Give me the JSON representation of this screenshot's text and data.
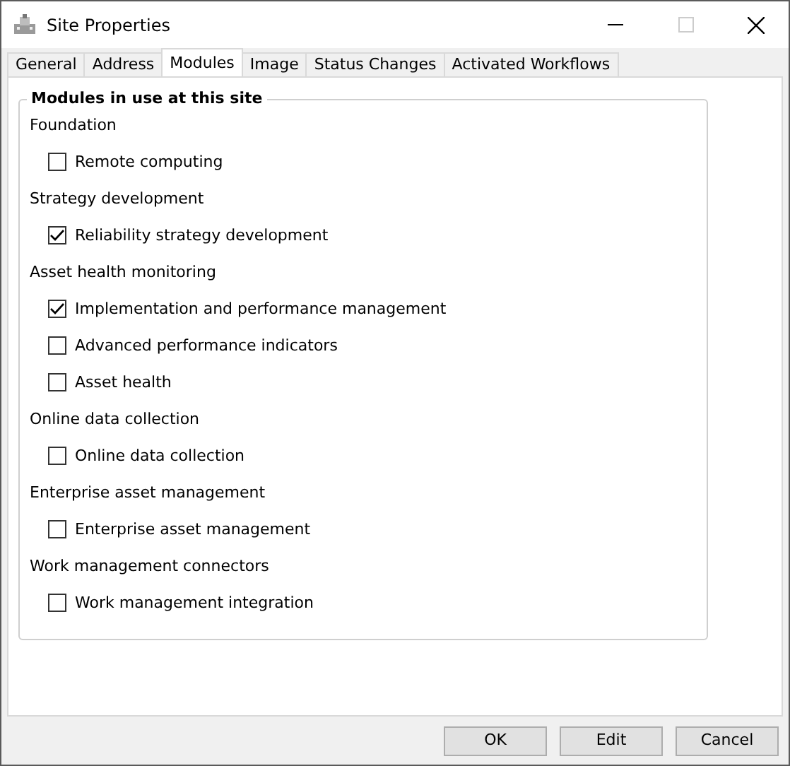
{
  "window": {
    "title": "Site Properties"
  },
  "tabs": [
    {
      "label": "General",
      "selected": false
    },
    {
      "label": "Address",
      "selected": false
    },
    {
      "label": "Modules",
      "selected": true
    },
    {
      "label": "Image",
      "selected": false
    },
    {
      "label": "Status Changes",
      "selected": false
    },
    {
      "label": "Activated Workflows",
      "selected": false
    }
  ],
  "group": {
    "title": "Modules in use at this site",
    "sections": [
      {
        "heading": "Foundation",
        "items": [
          {
            "label": "Remote computing",
            "checked": false
          }
        ]
      },
      {
        "heading": "Strategy development",
        "items": [
          {
            "label": "Reliability strategy development",
            "checked": true
          }
        ]
      },
      {
        "heading": "Asset health monitoring",
        "items": [
          {
            "label": "Implementation and performance management",
            "checked": true
          },
          {
            "label": "Advanced performance indicators",
            "checked": false
          },
          {
            "label": "Asset health",
            "checked": false
          }
        ]
      },
      {
        "heading": "Online data collection",
        "items": [
          {
            "label": "Online data collection",
            "checked": false
          }
        ]
      },
      {
        "heading": "Enterprise asset management",
        "items": [
          {
            "label": "Enterprise asset management",
            "checked": false
          }
        ]
      },
      {
        "heading": "Work management connectors",
        "items": [
          {
            "label": "Work management integration",
            "checked": false
          }
        ]
      }
    ]
  },
  "buttons": [
    "OK",
    "Edit",
    "Cancel"
  ]
}
